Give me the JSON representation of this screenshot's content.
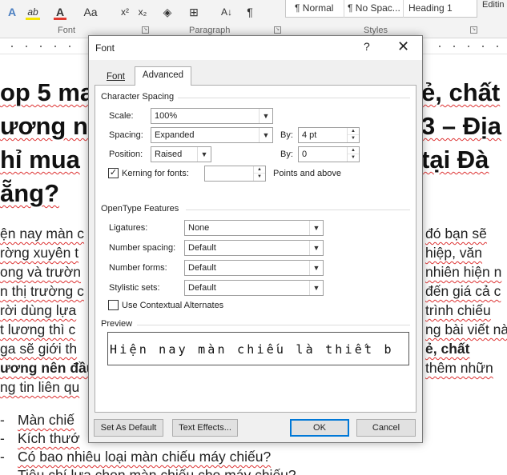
{
  "ribbon": {
    "font_group_label": "Font",
    "paragraph_group_label": "Paragraph",
    "styles_group_label": "Styles",
    "editing_label": "Editin",
    "styles": [
      "¶ Normal",
      "¶ No Spac...",
      "Heading 1"
    ],
    "glyphs": {
      "text_effects": "A",
      "highlight": "ab",
      "font_color": "A",
      "change_case": "Aa",
      "superscript": "x²",
      "subscript": "x₂",
      "sort": "A↓",
      "pilcrow": "¶"
    }
  },
  "document": {
    "heading_lines": [
      "op 5 ma",
      "ương nê",
      "hỉ mua",
      "ẵng?"
    ],
    "heading_right_lines": [
      "ẻ, chất",
      "3 – Địa",
      "tại Đà"
    ],
    "body_lines_left": [
      "ện nay màn c",
      "rờng xuyên t",
      "ong và trườn",
      "n thị trường c",
      "rời dùng lựa",
      "t lương thì c",
      "ga sẽ giới th",
      "ương nên đầu",
      "ng tin liên qu"
    ],
    "body_lines_right": [
      "đó bạn sẽ",
      "hiệp, văn",
      "nhiên hiện n",
      "đến giá cả c",
      "trình chiếu",
      "ng bài viết nà",
      "ẻ, chất",
      "thêm nhữn"
    ],
    "bullets": [
      "Màn chiế",
      "Kích thướ",
      "Có bao nhiêu loại màn chiếu máy chiếu?",
      "Tiêu chí lựa chọn màn chiếu cho máy chiếu?"
    ]
  },
  "dialog": {
    "title": "Font",
    "help": "?",
    "close": "✕",
    "tabs": {
      "font": "Font",
      "advanced": "Advanced"
    },
    "character_spacing": {
      "section_label": "Character Spacing",
      "scale_label": "Scale:",
      "scale_value": "100%",
      "spacing_label": "Spacing:",
      "spacing_value": "Expanded",
      "spacing_by_label": "By:",
      "spacing_by_value": "4 pt",
      "position_label": "Position:",
      "position_value": "Raised",
      "position_by_label": "By:",
      "position_by_value": "0",
      "kerning_label": "Kerning for fonts:",
      "kerning_checked": true,
      "kerning_value": "",
      "points_label": "Points and above"
    },
    "opentype": {
      "section_label": "OpenType Features",
      "ligatures_label": "Ligatures:",
      "ligatures_value": "None",
      "number_spacing_label": "Number spacing:",
      "number_spacing_value": "Default",
      "number_forms_label": "Number forms:",
      "number_forms_value": "Default",
      "stylistic_sets_label": "Stylistic sets:",
      "stylistic_sets_value": "Default",
      "contextual_label": "Use Contextual Alternates",
      "contextual_checked": false
    },
    "preview": {
      "section_label": "Preview",
      "text": "Hiện nay màn chiếu là thiết b"
    },
    "buttons": {
      "set_default": "Set As Default",
      "text_effects": "Text Effects...",
      "ok": "OK",
      "cancel": "Cancel"
    }
  },
  "colors": {
    "accent": "#0078d7",
    "font_color_bar": "#e03a2f",
    "highlight_bar": "#f5e400",
    "squiggle": "#dd3333"
  }
}
